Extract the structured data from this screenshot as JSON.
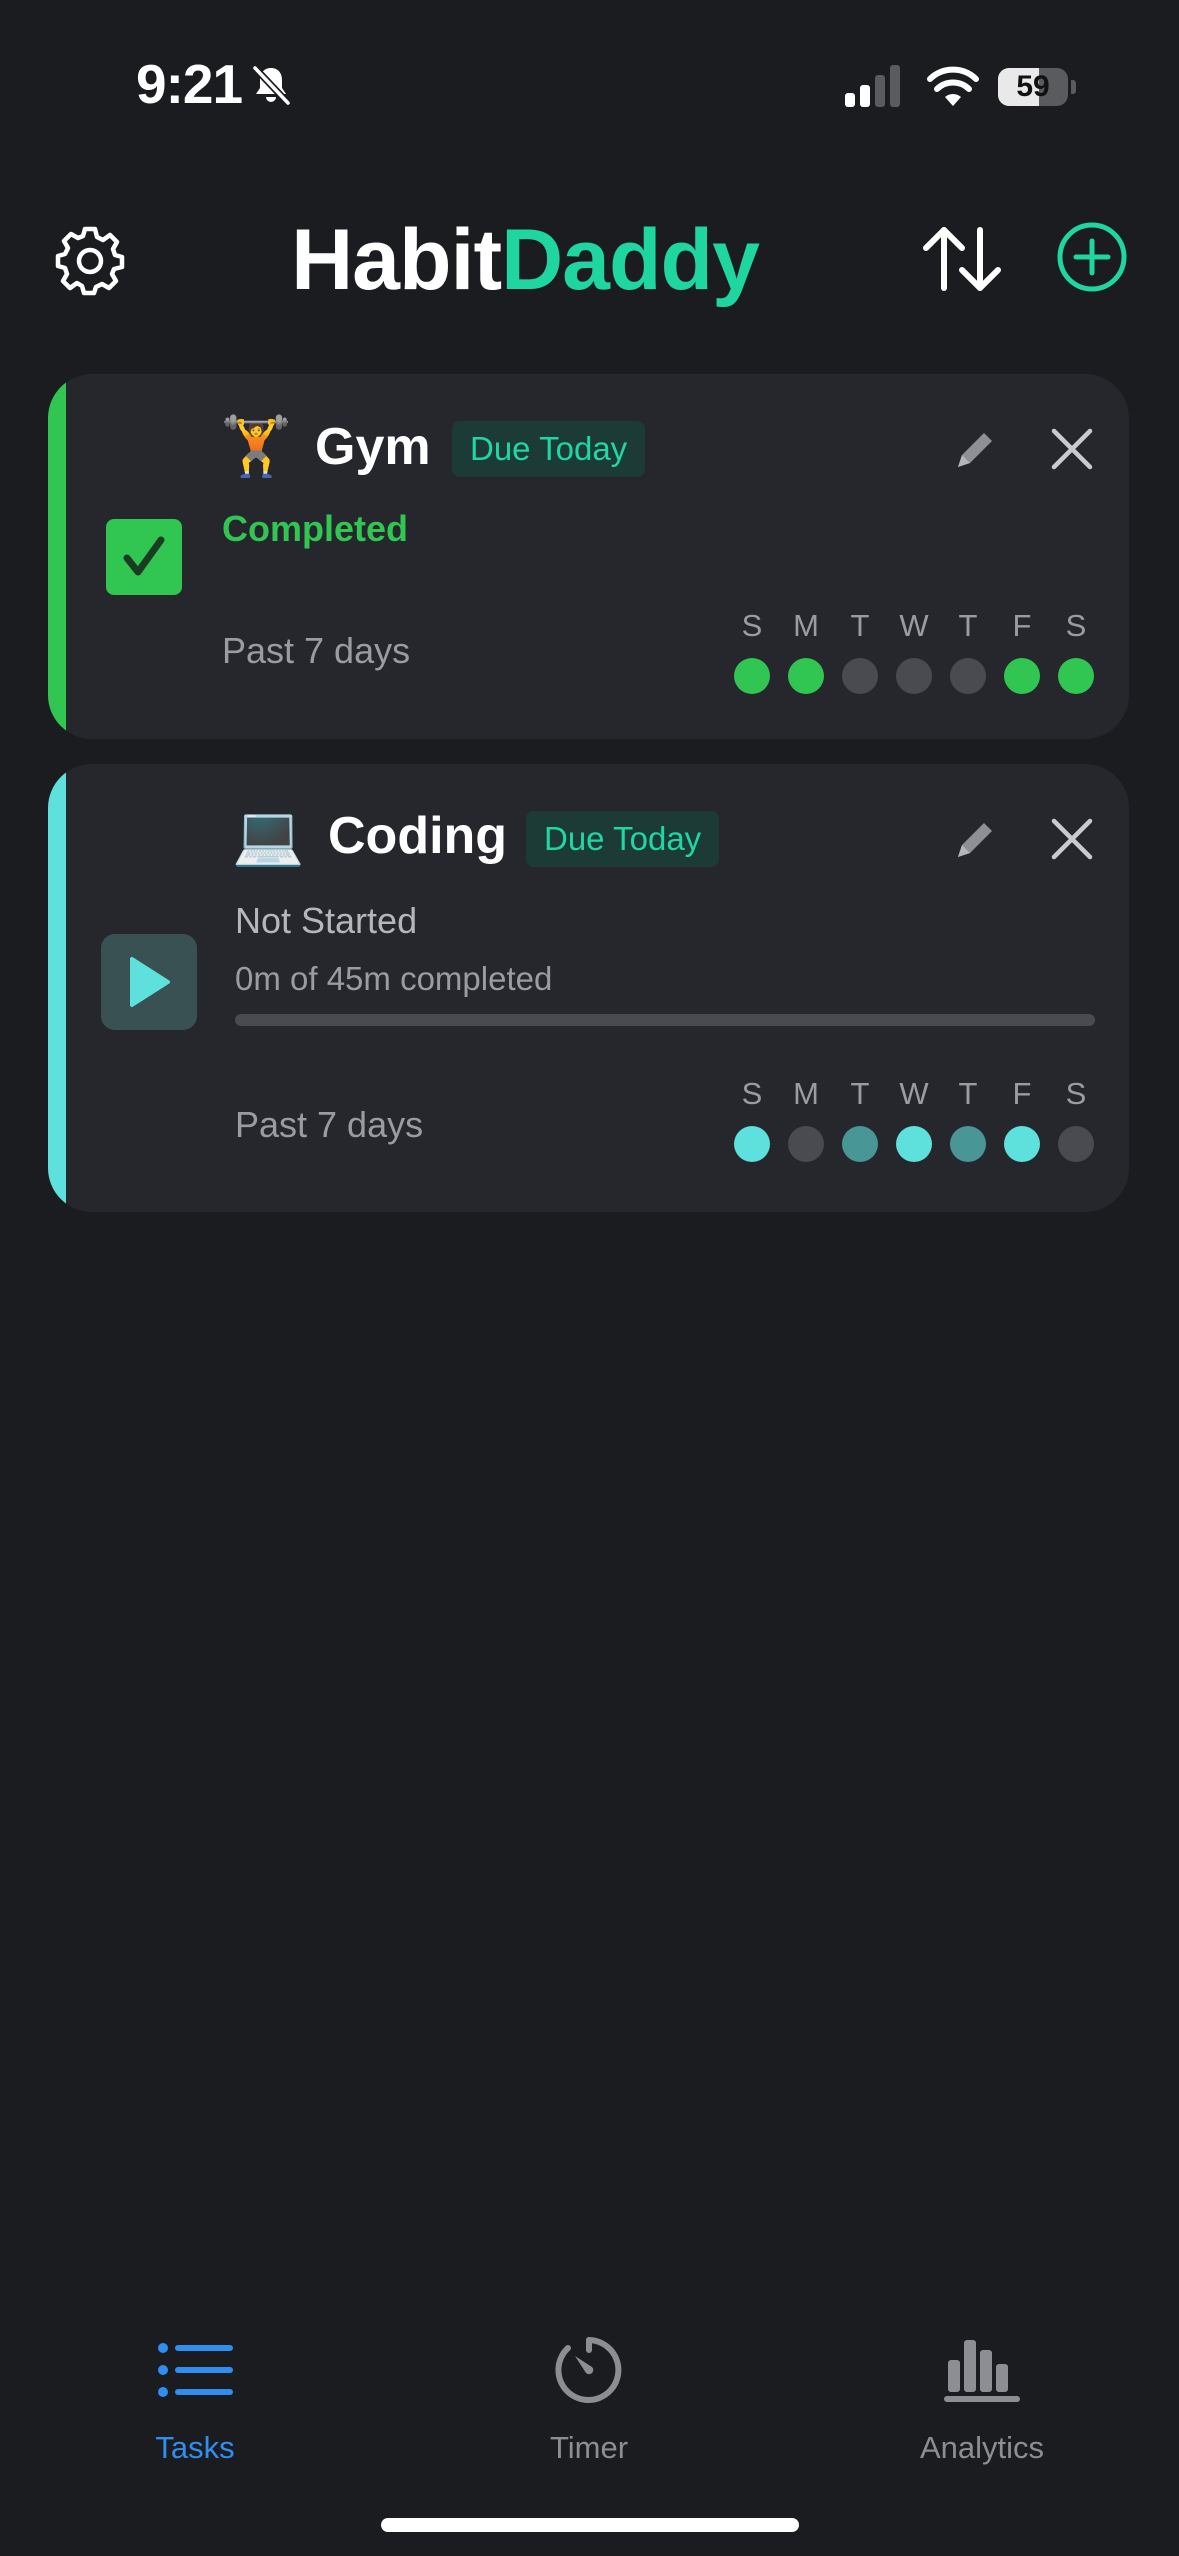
{
  "status_bar": {
    "time": "9:21",
    "battery": "59",
    "battery_level": 0.59
  },
  "header": {
    "title_part1": "Habit",
    "title_part2": "Daddy",
    "accent_color": "#1fd6a0"
  },
  "tasks": [
    {
      "emoji": "🏋️",
      "title": "Gym",
      "badge": "Due Today",
      "status": "Completed",
      "past_label": "Past 7 days",
      "color": "#31c552",
      "days": [
        {
          "letter": "S",
          "state": "done"
        },
        {
          "letter": "M",
          "state": "done"
        },
        {
          "letter": "T",
          "state": "none"
        },
        {
          "letter": "W",
          "state": "none"
        },
        {
          "letter": "T",
          "state": "none"
        },
        {
          "letter": "F",
          "state": "done"
        },
        {
          "letter": "S",
          "state": "done"
        }
      ]
    },
    {
      "emoji": "💻",
      "title": "Coding",
      "badge": "Due Today",
      "status": "Not Started",
      "progress_text": "0m of 45m completed",
      "progress": 0,
      "past_label": "Past 7 days",
      "color": "#5ee0dc",
      "days": [
        {
          "letter": "S",
          "state": "done"
        },
        {
          "letter": "M",
          "state": "none"
        },
        {
          "letter": "T",
          "state": "partial"
        },
        {
          "letter": "W",
          "state": "done"
        },
        {
          "letter": "T",
          "state": "partial"
        },
        {
          "letter": "F",
          "state": "done"
        },
        {
          "letter": "S",
          "state": "none"
        }
      ]
    }
  ],
  "tab_bar": {
    "tabs": [
      {
        "label": "Tasks",
        "icon": "list-icon",
        "active": true
      },
      {
        "label": "Timer",
        "icon": "timer-icon",
        "active": false
      },
      {
        "label": "Analytics",
        "icon": "bar-chart-icon",
        "active": false
      }
    ],
    "active_color": "#2f8ef0"
  }
}
